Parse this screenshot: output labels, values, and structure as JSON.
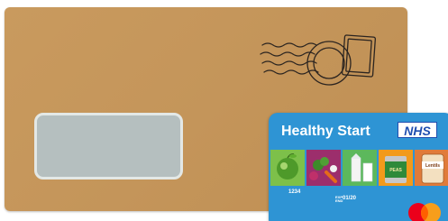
{
  "card": {
    "title": "Healthy Start",
    "logo_text": "NHS",
    "number": "1234",
    "expiry_label_top": "EXP",
    "expiry_label_bottom": "END",
    "expiry": "01/20",
    "peas_label": "PEAS",
    "lentils_label": "Lentils",
    "network_icon": "mastercard-icon"
  },
  "colors": {
    "envelope": "#c4955a",
    "window": "#b5bfbf",
    "card": "#2e94d4",
    "nhs_blue": "#1f4eb0"
  }
}
